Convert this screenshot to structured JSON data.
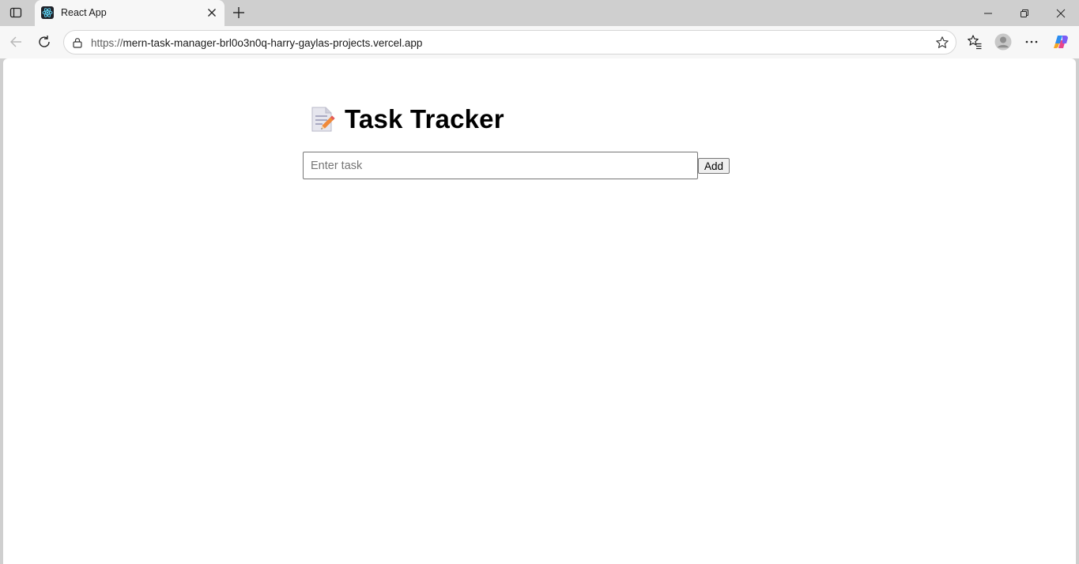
{
  "browser": {
    "tab": {
      "title": "React App",
      "favicon": "react-logo-icon"
    },
    "address_bar": {
      "scheme": "https://",
      "host": "mern-task-manager-brl0o3n0q-harry-gaylas-projects.vercel.app"
    },
    "icons": [
      "tab-actions-icon",
      "close-icon",
      "plus-icon",
      "minimize-icon",
      "restore-icon",
      "close-window-icon",
      "back-arrow-icon",
      "reload-icon",
      "lock-icon",
      "star-icon",
      "favorites-icon",
      "profile-avatar-icon",
      "more-icon",
      "copilot-icon"
    ]
  },
  "app": {
    "heading_icon": "memo-icon",
    "title": "Task Tracker",
    "task_input": {
      "placeholder": "Enter task",
      "value": ""
    },
    "add_label": "Add"
  }
}
